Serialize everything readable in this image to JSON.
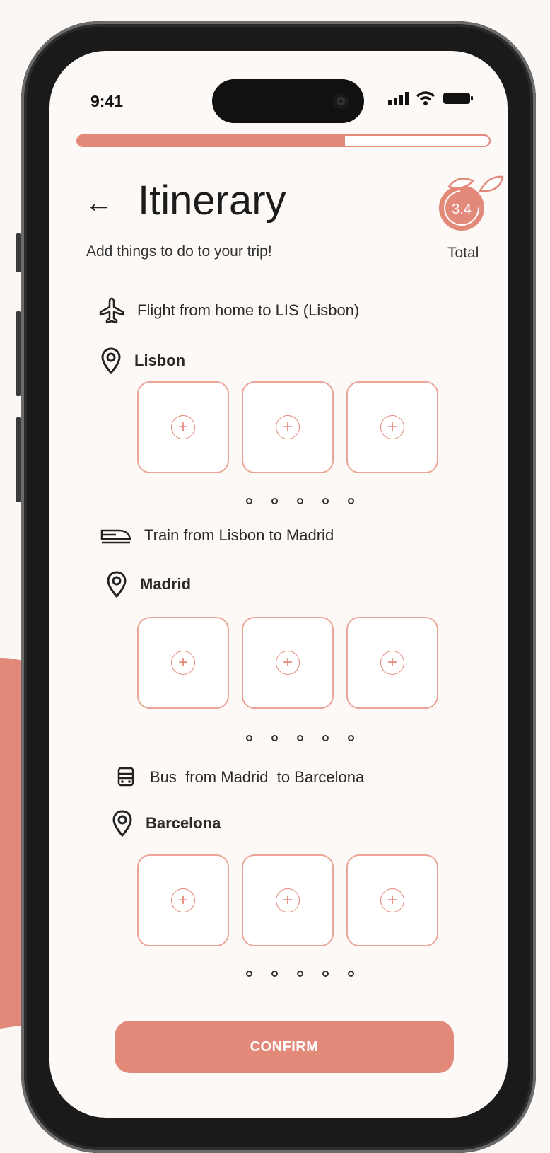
{
  "status": {
    "time": "9:41"
  },
  "progress": {
    "fraction": 0.65
  },
  "header": {
    "back_label": "←",
    "title": "Itinerary",
    "subtitle": "Add things to do to your trip!"
  },
  "score": {
    "value": "3.4",
    "label": "Total"
  },
  "segments": {
    "flight": "Flight from home to LIS (Lisbon)",
    "train": "Train from Lisbon to Madrid",
    "bus": "Bus  from Madrid  to Barcelona"
  },
  "cities": {
    "lisbon": "Lisbon",
    "madrid": "Madrid",
    "barcelona": "Barcelona"
  },
  "add_symbol": "+",
  "confirm_label": "CONFIRM",
  "colors": {
    "accent": "#e3897a",
    "background": "#fdf9f6"
  }
}
